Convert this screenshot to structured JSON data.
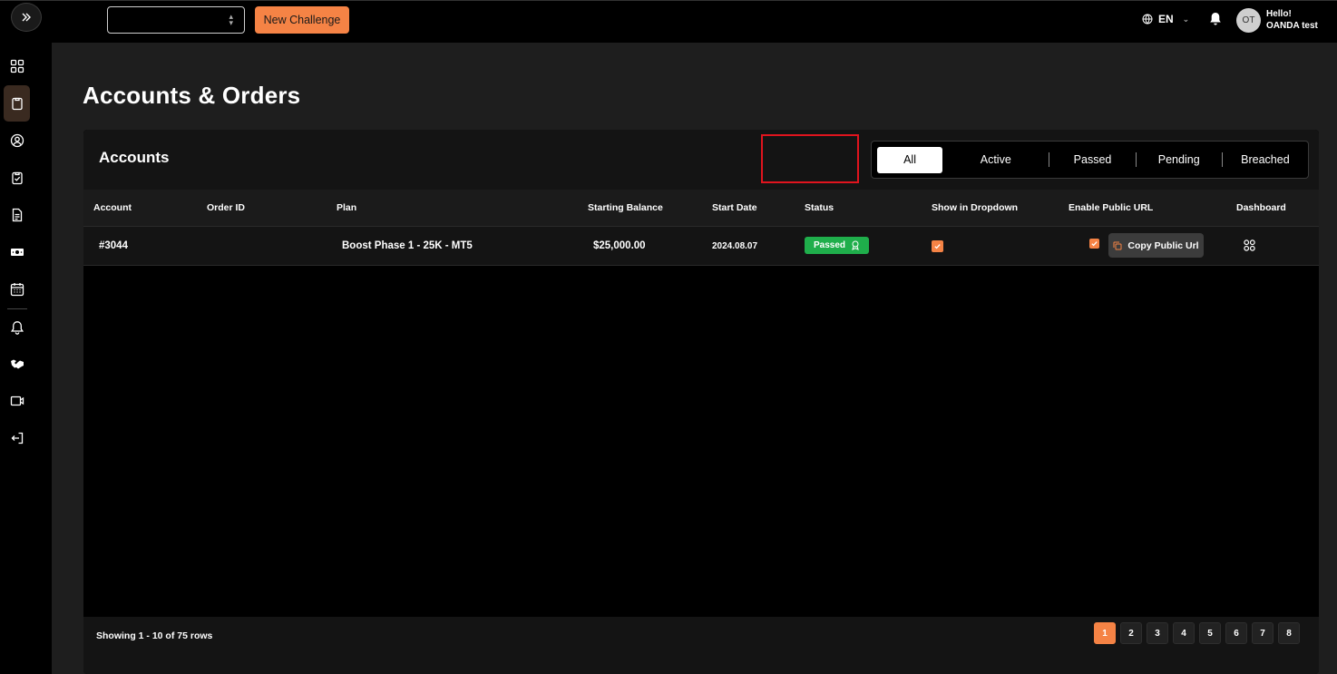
{
  "topbar": {
    "new_challenge_label": "New Challenge",
    "language": "EN",
    "user_initials": "OT",
    "greeting": "Hello!",
    "user_name": "OANDA test"
  },
  "page": {
    "title": "Accounts & Orders"
  },
  "accounts": {
    "title": "Accounts",
    "tabs": [
      "All",
      "Active",
      "Passed",
      "Pending",
      "Breached"
    ],
    "active_tab": "All",
    "columns": [
      "Account",
      "Order ID",
      "Plan",
      "Starting Balance",
      "Start Date",
      "Status",
      "Show in Dropdown",
      "Enable Public URL",
      "Dashboard"
    ],
    "rows": [
      {
        "account": "#3044",
        "order_id": "",
        "plan": "Boost Phase 1 - 25K - MT5",
        "starting_balance": "$25,000.00",
        "start_date": "2024.08.07",
        "status": "Passed",
        "show_in_dropdown": true,
        "enable_public_url": true,
        "copy_label": "Copy Public Url"
      }
    ],
    "footer": {
      "showing": "Showing 1 - 10 of 75 rows",
      "pages": [
        "1",
        "2",
        "3",
        "4",
        "5",
        "6",
        "7",
        "8"
      ],
      "current_page": "1"
    }
  },
  "colors": {
    "accent": "#f58345",
    "passed": "#1fae4b",
    "highlight": "#e0141e"
  }
}
